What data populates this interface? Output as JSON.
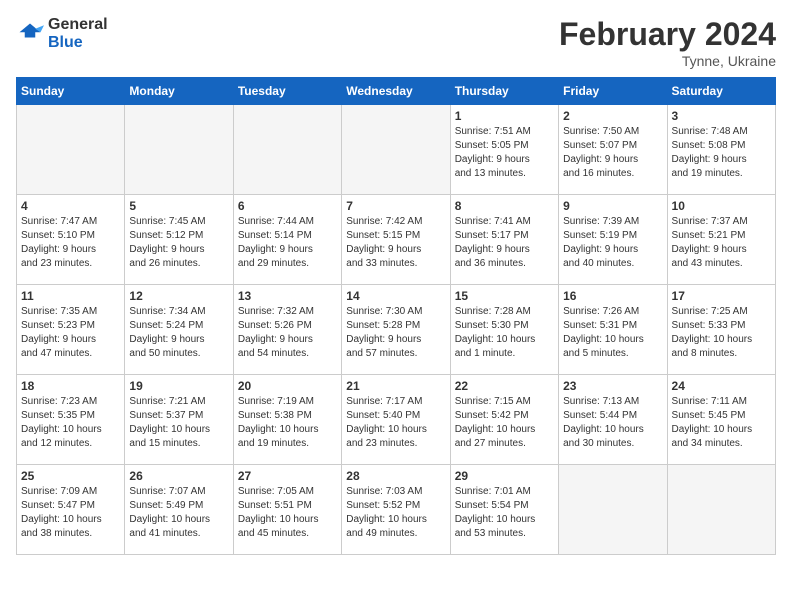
{
  "header": {
    "logo_line1": "General",
    "logo_line2": "Blue",
    "month_year": "February 2024",
    "location": "Tynne, Ukraine"
  },
  "weekdays": [
    "Sunday",
    "Monday",
    "Tuesday",
    "Wednesday",
    "Thursday",
    "Friday",
    "Saturday"
  ],
  "weeks": [
    [
      {
        "day": "",
        "info": ""
      },
      {
        "day": "",
        "info": ""
      },
      {
        "day": "",
        "info": ""
      },
      {
        "day": "",
        "info": ""
      },
      {
        "day": "1",
        "info": "Sunrise: 7:51 AM\nSunset: 5:05 PM\nDaylight: 9 hours\nand 13 minutes."
      },
      {
        "day": "2",
        "info": "Sunrise: 7:50 AM\nSunset: 5:07 PM\nDaylight: 9 hours\nand 16 minutes."
      },
      {
        "day": "3",
        "info": "Sunrise: 7:48 AM\nSunset: 5:08 PM\nDaylight: 9 hours\nand 19 minutes."
      }
    ],
    [
      {
        "day": "4",
        "info": "Sunrise: 7:47 AM\nSunset: 5:10 PM\nDaylight: 9 hours\nand 23 minutes."
      },
      {
        "day": "5",
        "info": "Sunrise: 7:45 AM\nSunset: 5:12 PM\nDaylight: 9 hours\nand 26 minutes."
      },
      {
        "day": "6",
        "info": "Sunrise: 7:44 AM\nSunset: 5:14 PM\nDaylight: 9 hours\nand 29 minutes."
      },
      {
        "day": "7",
        "info": "Sunrise: 7:42 AM\nSunset: 5:15 PM\nDaylight: 9 hours\nand 33 minutes."
      },
      {
        "day": "8",
        "info": "Sunrise: 7:41 AM\nSunset: 5:17 PM\nDaylight: 9 hours\nand 36 minutes."
      },
      {
        "day": "9",
        "info": "Sunrise: 7:39 AM\nSunset: 5:19 PM\nDaylight: 9 hours\nand 40 minutes."
      },
      {
        "day": "10",
        "info": "Sunrise: 7:37 AM\nSunset: 5:21 PM\nDaylight: 9 hours\nand 43 minutes."
      }
    ],
    [
      {
        "day": "11",
        "info": "Sunrise: 7:35 AM\nSunset: 5:23 PM\nDaylight: 9 hours\nand 47 minutes."
      },
      {
        "day": "12",
        "info": "Sunrise: 7:34 AM\nSunset: 5:24 PM\nDaylight: 9 hours\nand 50 minutes."
      },
      {
        "day": "13",
        "info": "Sunrise: 7:32 AM\nSunset: 5:26 PM\nDaylight: 9 hours\nand 54 minutes."
      },
      {
        "day": "14",
        "info": "Sunrise: 7:30 AM\nSunset: 5:28 PM\nDaylight: 9 hours\nand 57 minutes."
      },
      {
        "day": "15",
        "info": "Sunrise: 7:28 AM\nSunset: 5:30 PM\nDaylight: 10 hours\nand 1 minute."
      },
      {
        "day": "16",
        "info": "Sunrise: 7:26 AM\nSunset: 5:31 PM\nDaylight: 10 hours\nand 5 minutes."
      },
      {
        "day": "17",
        "info": "Sunrise: 7:25 AM\nSunset: 5:33 PM\nDaylight: 10 hours\nand 8 minutes."
      }
    ],
    [
      {
        "day": "18",
        "info": "Sunrise: 7:23 AM\nSunset: 5:35 PM\nDaylight: 10 hours\nand 12 minutes."
      },
      {
        "day": "19",
        "info": "Sunrise: 7:21 AM\nSunset: 5:37 PM\nDaylight: 10 hours\nand 15 minutes."
      },
      {
        "day": "20",
        "info": "Sunrise: 7:19 AM\nSunset: 5:38 PM\nDaylight: 10 hours\nand 19 minutes."
      },
      {
        "day": "21",
        "info": "Sunrise: 7:17 AM\nSunset: 5:40 PM\nDaylight: 10 hours\nand 23 minutes."
      },
      {
        "day": "22",
        "info": "Sunrise: 7:15 AM\nSunset: 5:42 PM\nDaylight: 10 hours\nand 27 minutes."
      },
      {
        "day": "23",
        "info": "Sunrise: 7:13 AM\nSunset: 5:44 PM\nDaylight: 10 hours\nand 30 minutes."
      },
      {
        "day": "24",
        "info": "Sunrise: 7:11 AM\nSunset: 5:45 PM\nDaylight: 10 hours\nand 34 minutes."
      }
    ],
    [
      {
        "day": "25",
        "info": "Sunrise: 7:09 AM\nSunset: 5:47 PM\nDaylight: 10 hours\nand 38 minutes."
      },
      {
        "day": "26",
        "info": "Sunrise: 7:07 AM\nSunset: 5:49 PM\nDaylight: 10 hours\nand 41 minutes."
      },
      {
        "day": "27",
        "info": "Sunrise: 7:05 AM\nSunset: 5:51 PM\nDaylight: 10 hours\nand 45 minutes."
      },
      {
        "day": "28",
        "info": "Sunrise: 7:03 AM\nSunset: 5:52 PM\nDaylight: 10 hours\nand 49 minutes."
      },
      {
        "day": "29",
        "info": "Sunrise: 7:01 AM\nSunset: 5:54 PM\nDaylight: 10 hours\nand 53 minutes."
      },
      {
        "day": "",
        "info": ""
      },
      {
        "day": "",
        "info": ""
      }
    ]
  ]
}
